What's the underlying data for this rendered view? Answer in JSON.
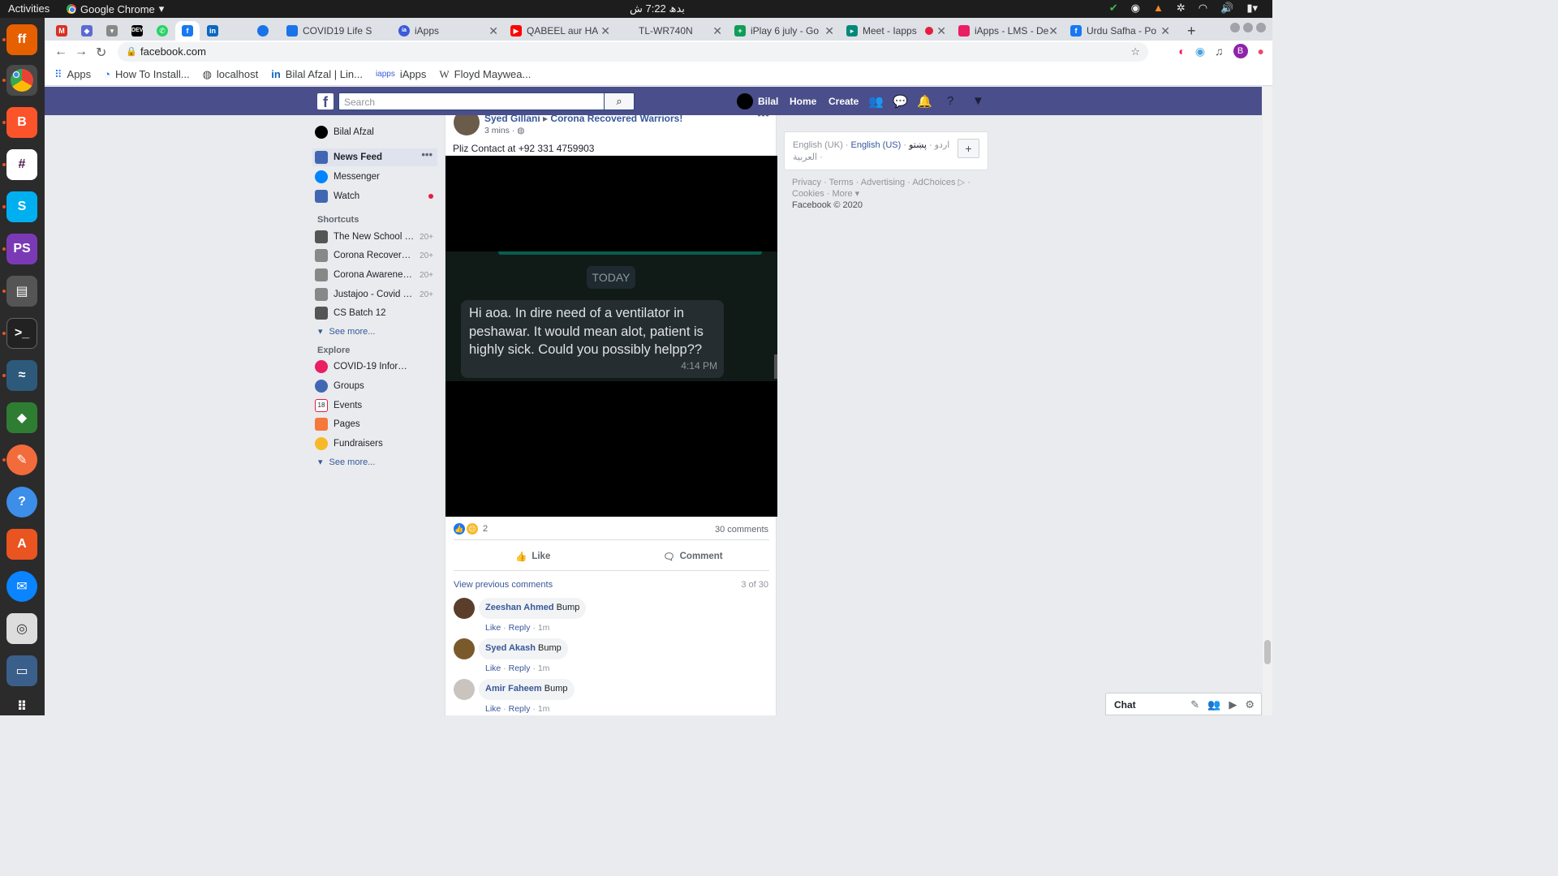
{
  "system": {
    "activities": "Activities",
    "app_name": "Google Chrome",
    "clock": "بدھ 7:22 ش"
  },
  "tabs": [
    {
      "title": "COVID19 Life S",
      "color": "#1a73e8"
    },
    {
      "title": "iApps",
      "color": "#3b5bdb"
    },
    {
      "title": "QABEEL aur HA",
      "color": "#ff0000"
    },
    {
      "title": "TL-WR740N",
      "color": "#888888"
    },
    {
      "title": "iPlay 6 july - Go",
      "color": "#0f9d58"
    },
    {
      "title": "Meet - Iapps",
      "color": "#00897b"
    },
    {
      "title": "iApps - LMS - De",
      "color": "#e91e63"
    },
    {
      "title": "Urdu Safha - Po",
      "color": "#1877f2"
    }
  ],
  "address": "facebook.com",
  "bookmarks": [
    "Apps",
    "How To Install...",
    "localhost",
    "Bilal Afzal | Lin...",
    "iApps",
    "Floyd Maywea..."
  ],
  "fb": {
    "search_placeholder": "Search",
    "user": "Bilal",
    "nav_home": "Home",
    "nav_create": "Create",
    "left": {
      "profile": "Bilal Afzal",
      "news_feed": "News Feed",
      "messenger": "Messenger",
      "watch": "Watch",
      "shortcuts_title": "Shortcuts",
      "shortcuts": [
        {
          "label": "The New School L...",
          "count": "20+"
        },
        {
          "label": "Corona Recovered ...",
          "count": "20+"
        },
        {
          "label": "Corona Awareness...",
          "count": "20+"
        },
        {
          "label": "Justajoo - Covid M...",
          "count": "20+"
        },
        {
          "label": "CS Batch 12",
          "count": ""
        }
      ],
      "see_more": "See more...",
      "explore_title": "Explore",
      "explore": [
        "COVID-19 Informat...",
        "Groups",
        "Events",
        "Pages",
        "Fundraisers"
      ],
      "see_more2": "See more..."
    },
    "post": {
      "author": "Syed Gillani",
      "group": "Corona Recovered Warriors!",
      "time": "3 mins · ",
      "text": "Pliz Contact at +92 331 4759903",
      "image": {
        "today": "TODAY",
        "message": "Hi aoa. In dire need of a ventilator in peshawar. It would mean alot, patient is highly sick. Could you possibly helpp??",
        "msg_time": "4:14 PM"
      },
      "reactions": "2",
      "comments_count": "30 comments",
      "like": "Like",
      "comment": "Comment",
      "view_previous": "View previous comments",
      "page_count": "3 of 30",
      "comments": [
        {
          "name": "Zeeshan Ahmed",
          "text": "Bump",
          "meta_like": "Like",
          "meta_reply": "Reply",
          "meta_time": "1m"
        },
        {
          "name": "Syed Akash",
          "text": "Bump",
          "meta_like": "Like",
          "meta_reply": "Reply",
          "meta_time": "1m"
        },
        {
          "name": "Amir Faheem",
          "text": "Bump",
          "meta_like": "Like",
          "meta_reply": "Reply",
          "meta_time": "1m"
        }
      ]
    },
    "languages": {
      "uk": "English (UK)",
      "us": "English (US)",
      "urdu": "اردو",
      "pashto": "پښتو",
      "arabic": "العربية"
    },
    "footer": {
      "line1": "Privacy · Terms · Advertising · AdChoices ▷ ·",
      "line2": "Cookies · More ▾",
      "copyright": "Facebook © 2020"
    },
    "chat": "Chat"
  },
  "colors": {
    "fb_header": "#4a4e8a",
    "link": "#365899",
    "notification_dot": "#e41e3f"
  }
}
